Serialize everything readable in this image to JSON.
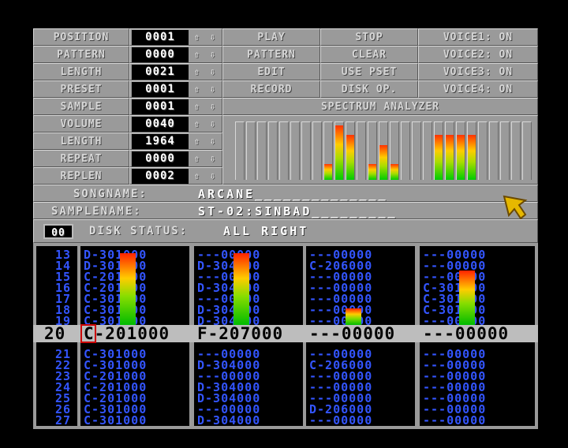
{
  "left_panel": [
    {
      "label": "POSITION",
      "value": "0001"
    },
    {
      "label": "PATTERN",
      "value": "0000"
    },
    {
      "label": "LENGTH",
      "value": "0021"
    },
    {
      "label": "PRESET",
      "value": "0001"
    },
    {
      "label": "SAMPLE",
      "value": "0001"
    },
    {
      "label": "VOLUME",
      "value": "0040"
    },
    {
      "label": "LENGTH",
      "value": "1964"
    },
    {
      "label": "REPEAT",
      "value": "0000"
    },
    {
      "label": "REPLEN",
      "value": "0002"
    }
  ],
  "arrow_up": "⇧",
  "arrow_down": "⇩",
  "buttons": [
    [
      "PLAY",
      "STOP",
      "VOICE1: ON"
    ],
    [
      "PATTERN",
      "CLEAR",
      "VOICE2: ON"
    ],
    [
      "EDIT",
      "USE PSET",
      "VOICE3: ON"
    ],
    [
      "RECORD",
      "DISK OP.",
      "VOICE4: ON"
    ]
  ],
  "spectrum": {
    "title": "SPECTRUM ANALYZER",
    "levels": [
      0,
      0,
      0,
      0,
      0,
      0,
      0,
      0,
      0.28,
      0.95,
      0.78,
      0,
      0.28,
      0.6,
      0.28,
      0,
      0,
      0,
      0.78,
      0.78,
      0.78,
      0.78,
      0,
      0,
      0,
      0,
      0
    ]
  },
  "songname": {
    "label": "SONGNAME:",
    "value": "ARCANE______________"
  },
  "samplename": {
    "label": "SAMPLENAME:",
    "value": "ST-02:SINBAD_________"
  },
  "disk": {
    "counter": "00",
    "label": "DISK STATUS:",
    "value": "ALL RIGHT"
  },
  "pattern": {
    "rows_above": [
      "13",
      "14",
      "15",
      "16",
      "17",
      "18",
      "19"
    ],
    "rows_below": [
      "21",
      "22",
      "23",
      "24",
      "25",
      "26",
      "27"
    ],
    "current_row": "20",
    "channels": [
      {
        "above": [
          "D-301000",
          "D-301000",
          "C-201000",
          "C-201000",
          "C-301000",
          "C-301000",
          "C-301000"
        ],
        "current": "C-201000",
        "below": [
          "C-301000",
          "C-301000",
          "C-201000",
          "C-201000",
          "C-201000",
          "C-301000",
          "C-301000"
        ],
        "vu": 0.95
      },
      {
        "above": [
          "---00000",
          "D-304000",
          "---00000",
          "D-304000",
          "---00000",
          "D-304000",
          "D-304000"
        ],
        "current": "F-207000",
        "below": [
          "---00000",
          "D-304000",
          "---00000",
          "D-304000",
          "D-304000",
          "---00000",
          "D-304000"
        ],
        "vu": 0.95
      },
      {
        "above": [
          "---00000",
          "C-206000",
          "---00000",
          "---00000",
          "---00000",
          "---00000",
          "---00000"
        ],
        "current": "---00000",
        "below": [
          "---00000",
          "C-206000",
          "---00000",
          "---00000",
          "---00000",
          "D-206000",
          "---00000"
        ],
        "vu": 0.22
      },
      {
        "above": [
          "---00000",
          "---00000",
          "---00000",
          "C-301000",
          "C-301000",
          "C-301000",
          "---00000"
        ],
        "current": "---00000",
        "below": [
          "---00000",
          "---00000",
          "---00000",
          "---00000",
          "---00000",
          "---00000",
          "---00000"
        ],
        "vu": 0.72
      }
    ]
  },
  "colors": {
    "panel": "#9a9a9a",
    "note": "#3355ff",
    "cursor": "#cc0000",
    "pointer": "#e6b800"
  }
}
